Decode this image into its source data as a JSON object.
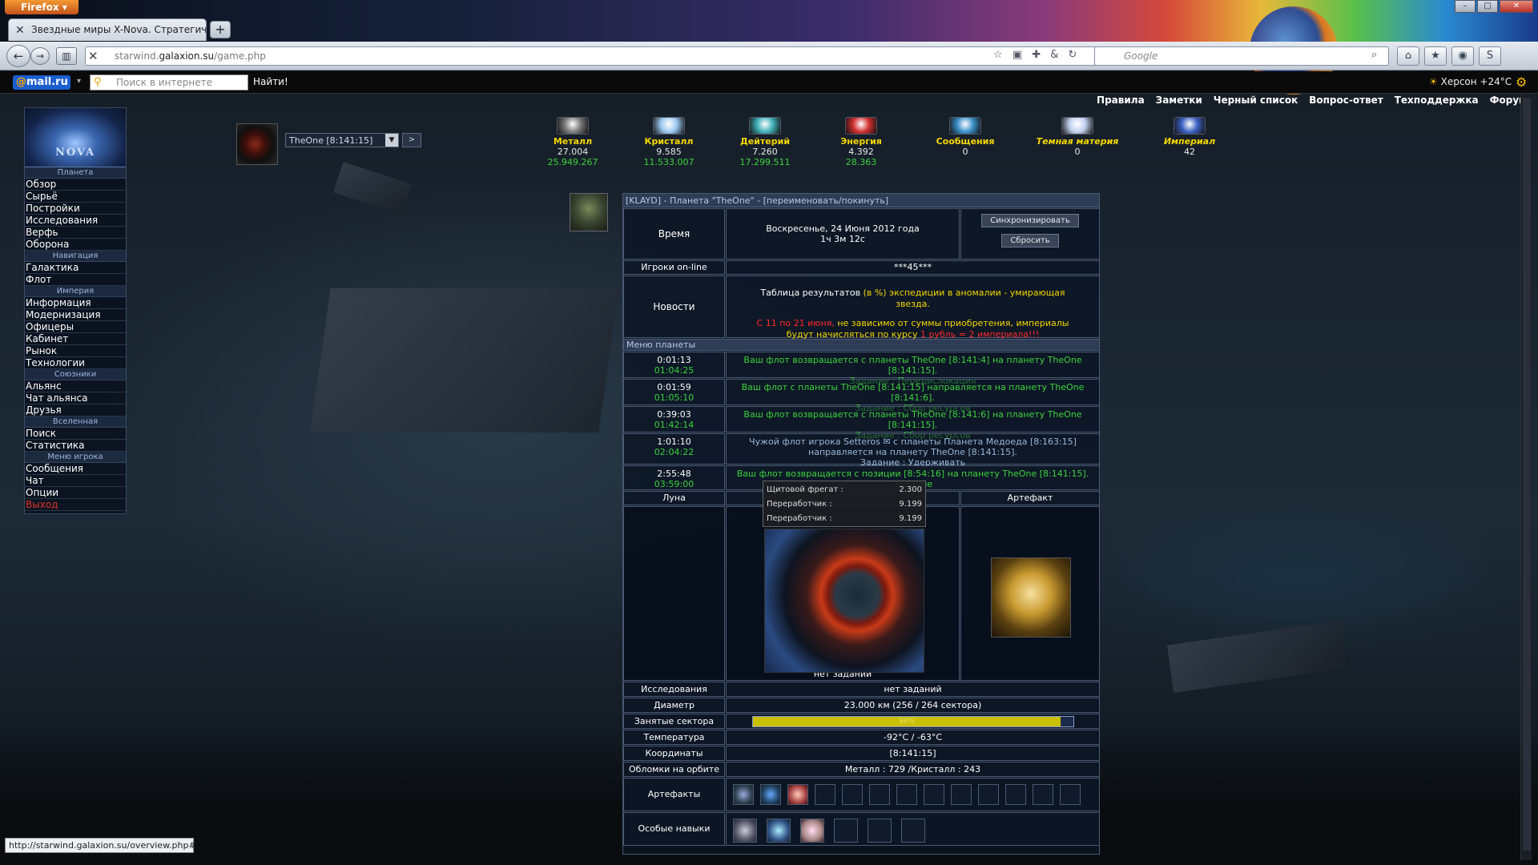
{
  "browser": {
    "app_button": "Firefox",
    "tab_title": "Звездные миры X-Nova. Стратегическ...",
    "url_prefix": "starwind.",
    "url_host": "galaxion.su",
    "url_path": "/game.php",
    "search_placeholder": "Google",
    "new_tab": "+"
  },
  "mailbar": {
    "logo_at": "@",
    "logo_text": "mail.ru",
    "search_placeholder": "Поиск в интернете",
    "find_button": "Найти!",
    "weather": "Херсон +24°C"
  },
  "top_links": [
    "Правила",
    "Заметки",
    "Черный список",
    "Вопрос-ответ",
    "Техподдержка",
    "Форум"
  ],
  "sidebar": {
    "logo_text": "NOVA",
    "sections": [
      {
        "header": "Планета",
        "items": [
          "Обзор",
          "Сырьё",
          "Постройки",
          "Исследования",
          "Верфь",
          "Оборона"
        ]
      },
      {
        "header": "Навигация",
        "items": [
          "Галактика",
          "Флот"
        ]
      },
      {
        "header": "Империя",
        "items": [
          "Информация",
          "Модернизация",
          "Офицеры",
          "Кабинет",
          "Рынок",
          "Технологии"
        ]
      },
      {
        "header": "Союзники",
        "items": [
          "Альянс",
          "Чат альянса",
          "Друзья"
        ]
      },
      {
        "header": "Вселенная",
        "items": [
          "Поиск",
          "Статистика"
        ]
      },
      {
        "header": "Меню игрока",
        "items": [
          "Сообщения",
          "Чат",
          "Опции",
          "Выход"
        ]
      }
    ]
  },
  "planet_selector": {
    "value": "TheOne [8:141:15]",
    "next": ">"
  },
  "resources": [
    {
      "name": "Металл",
      "v1": "27.004",
      "v2": "25.949.267",
      "color": "#7a7a7a"
    },
    {
      "name": "Кристалл",
      "v1": "9.585",
      "v2": "11.533.007",
      "color": "#9ac8f0"
    },
    {
      "name": "Дейтерий",
      "v1": "7.260",
      "v2": "17.299.511",
      "color": "#40b0b8"
    },
    {
      "name": "Энергия",
      "v1": "4.392",
      "v2": "28.363",
      "color": "#d03030"
    },
    {
      "name": "Сообщения",
      "v1": "0",
      "v2": "",
      "color": "#3a90c8"
    },
    {
      "name": "Темная материя",
      "v1": "0",
      "v2": "",
      "color": "#c0d0f0"
    },
    {
      "name": "Империал",
      "v1": "42",
      "v2": "",
      "color": "#3a60c0"
    }
  ],
  "main": {
    "title_prefix": "[KLAYD] - Планета \"TheOne\" - ",
    "title_link": "[переименовать/покинуть]",
    "time_label": "Время",
    "date": "Воскресенье, 24 Июня 2012 года",
    "uptime": "1ч 3м 12с",
    "sync_button": "Синхронизировать",
    "reset_button": "Сбросить",
    "online_label": "Игроки on-line",
    "online_value": "***45***",
    "news_label": "Новости",
    "news_line1_a": "Таблица результатов ",
    "news_line1_b": "(в %) экспедиции в аномалии - умирающая звезда.",
    "news_line2_a": "С 11 по 21 июня,",
    "news_line2_b": " не зависимо от суммы приобретения, империалы будут начисляться по курсу ",
    "news_line2_c": "1 рубль = 2 империала!!!",
    "planet_menu": "Меню планеты",
    "fleets": [
      {
        "t1": "0:01:13",
        "t2": "01:04:25",
        "text": "Ваш флот возвращается с планеты TheOne [8:141:4] на планету TheOne [8:141:15].",
        "task": "Задание : Передислокация"
      },
      {
        "t1": "0:01:59",
        "t2": "01:05:10",
        "text": "Ваш флот с планеты TheOne [8:141:15] направляется на планету TheOne [8:141:6].",
        "task": "Задание : Сбор ресурсов"
      },
      {
        "t1": "0:39:03",
        "t2": "01:42:14",
        "text": "Ваш флот возвращается с планеты TheOne [8:141:6] на планету TheOne [8:141:15].",
        "task": "Задание : Сбор ресурсов"
      },
      {
        "t1": "1:01:10",
        "t2": "02:04:22",
        "text": "Чужой флот игрока Setteros ✉ с планеты Планета Медоеда [8:163:15] направляется на планету TheOne [8:141:15].",
        "task": "Задание : Удерживать"
      },
      {
        "t1": "2:55:48",
        "t2": "03:59:00",
        "text": "Ваш флот возвращается с позиции [8:54:16] на планету TheOne [8:141:15]. Задание",
        "task": "ция"
      }
    ],
    "tooltip": [
      {
        "name": "Щитовой фрегат :",
        "value": "2.300"
      },
      {
        "name": "Переработчик :",
        "value": "9.199"
      },
      {
        "name": "Переработчик :",
        "value": "9.199"
      }
    ],
    "moon_label": "Луна",
    "artifact_label": "Артефакт",
    "no_tasks": "нет заданий",
    "rows": [
      {
        "label": "Исследования",
        "value": "нет заданий"
      },
      {
        "label": "Диаметр",
        "value": "23.000 км (256 / 264 сектора)"
      },
      {
        "label": "Занятые сектора",
        "value": "96%",
        "fill": 0.96
      },
      {
        "label": "Температура",
        "value": "-92°C / -63°C"
      },
      {
        "label": "Координаты",
        "value": "[8:141:15]"
      },
      {
        "label": "Обломки на орбите",
        "value": "Металл : 729 /Кристалл : 243"
      }
    ],
    "artifacts_label": "Артефакты",
    "skills_label": "Особые навыки"
  },
  "status_url": "http://starwind.galaxion.su/overview.php#"
}
